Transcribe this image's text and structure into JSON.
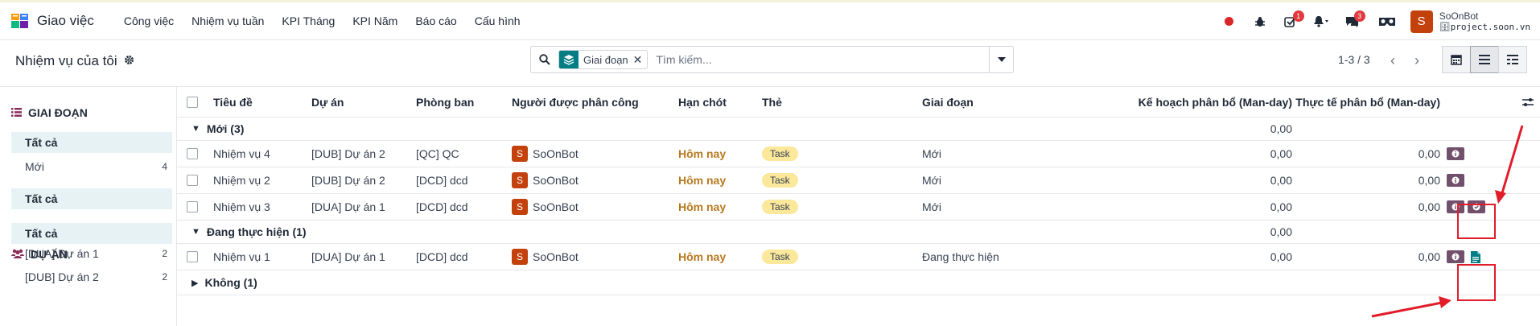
{
  "navbar": {
    "app_name": "Giao việc",
    "menu": [
      "Công việc",
      "Nhiệm vụ tuần",
      "KPI Tháng",
      "KPI Năm",
      "Báo cáo",
      "Cấu hình"
    ],
    "activity_badge": "1",
    "message_badge": "3",
    "user_initial": "S",
    "user_name": "SoOnBot",
    "user_db": "project.soon.vn"
  },
  "control": {
    "page_title": "Nhiệm vụ của tôi",
    "facet_label": "Giai đoạn",
    "search_placeholder": "Tìm kiếm...",
    "pager": "1-3 / 3"
  },
  "sidebar": {
    "stage_heading": "GIAI ĐOẠN",
    "stage_items": [
      {
        "label": "Tất cả",
        "count": ""
      },
      {
        "label": "Mới",
        "count": "4"
      }
    ],
    "project_heading": "DỰ ÁN",
    "project_items": [
      {
        "label": "Tất cả",
        "count": ""
      },
      {
        "label": "[DUA] Dự án 1",
        "count": "2"
      },
      {
        "label": "[DUB] Dự án 2",
        "count": "2"
      }
    ]
  },
  "table": {
    "headers": {
      "title": "Tiêu đề",
      "project": "Dự án",
      "department": "Phòng ban",
      "assignee": "Người được phân công",
      "deadline": "Hạn chót",
      "tags": "Thẻ",
      "stage": "Giai đoạn",
      "planned": "Kế hoạch phân bổ (Man-day)",
      "actual": "Thực tế phân bổ (Man-day)"
    },
    "groups": [
      {
        "label": "Mới (3)",
        "planned": "0,00"
      },
      {
        "label": "Đang thực hiện (1)",
        "planned": "0,00"
      },
      {
        "label": "Không (1)"
      }
    ],
    "rows": [
      {
        "title": "Nhiệm vụ 4",
        "project": "[DUB] Dự án 2",
        "department": "[QC] QC",
        "assignee_initial": "S",
        "assignee": "SoOnBot",
        "deadline": "Hôm nay",
        "tag": "Task",
        "stage": "Mới",
        "planned": "0,00",
        "actual": "0,00"
      },
      {
        "title": "Nhiệm vụ 2",
        "project": "[DUB] Dự án 2",
        "department": "[DCD] dcd",
        "assignee_initial": "S",
        "assignee": "SoOnBot",
        "deadline": "Hôm nay",
        "tag": "Task",
        "stage": "Mới",
        "planned": "0,00",
        "actual": "0,00"
      },
      {
        "title": "Nhiệm vụ 3",
        "project": "[DUA] Dự án 1",
        "department": "[DCD] dcd",
        "assignee_initial": "S",
        "assignee": "SoOnBot",
        "deadline": "Hôm nay",
        "tag": "Task",
        "stage": "Mới",
        "planned": "0,00",
        "actual": "0,00"
      },
      {
        "title": "Nhiệm vụ 1",
        "project": "[DUA] Dự án 1",
        "department": "[DCD] dcd",
        "assignee_initial": "S",
        "assignee": "SoOnBot",
        "deadline": "Hôm nay",
        "tag": "Task",
        "stage": "Đang thực hiện",
        "planned": "0,00",
        "actual": "0,00"
      }
    ]
  },
  "colors": {
    "accent": "#017e84",
    "action_button": "#71506b",
    "deadline": "#b7791f",
    "tag": "#fbe89a",
    "annotation": "#e11d2a"
  }
}
